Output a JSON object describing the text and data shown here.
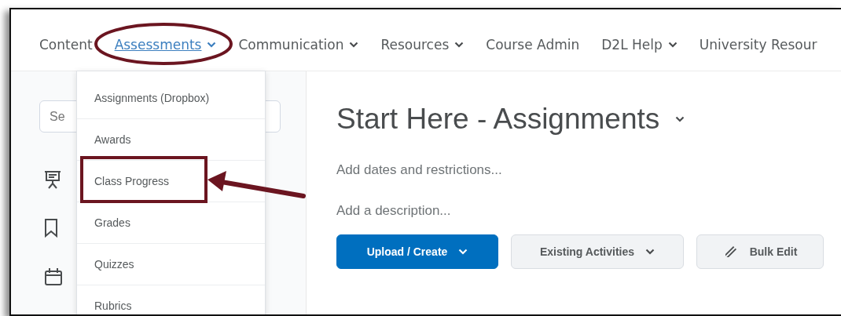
{
  "nav": {
    "items": [
      {
        "label": "Content",
        "has_menu": false,
        "selected": false
      },
      {
        "label": "Assessments",
        "has_menu": true,
        "selected": true
      },
      {
        "label": "Communication",
        "has_menu": true,
        "selected": false
      },
      {
        "label": "Resources",
        "has_menu": true,
        "selected": false
      },
      {
        "label": "Course Admin",
        "has_menu": false,
        "selected": false
      },
      {
        "label": "D2L Help",
        "has_menu": true,
        "selected": false
      },
      {
        "label": "University Resour",
        "has_menu": false,
        "selected": false
      }
    ]
  },
  "sidebar": {
    "search": {
      "placeholder": "Se"
    }
  },
  "menu": {
    "items": [
      {
        "label": "Assignments (Dropbox)"
      },
      {
        "label": "Awards"
      },
      {
        "label": "Class Progress"
      },
      {
        "label": "Grades"
      },
      {
        "label": "Quizzes"
      },
      {
        "label": "Rubrics"
      }
    ]
  },
  "page": {
    "title": "Start Here - Assignments",
    "dates_link": "Add dates and restrictions...",
    "description_link": "Add a description...",
    "buttons": [
      {
        "label": "Upload / Create",
        "kind": "primary",
        "has_menu": true
      },
      {
        "label": "Existing Activities",
        "kind": "secondary",
        "has_menu": true
      },
      {
        "label": "Bulk Edit",
        "kind": "edit",
        "has_menu": false
      }
    ]
  },
  "annotations": [
    {
      "kind": "ellipse"
    },
    {
      "kind": "box"
    },
    {
      "kind": "arrow"
    }
  ]
}
